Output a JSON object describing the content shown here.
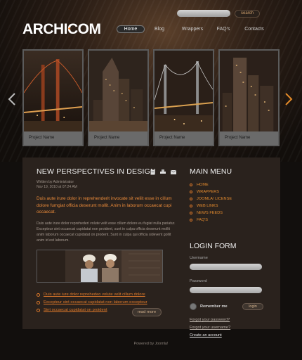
{
  "header": {
    "logo_prefix": "ARCHI",
    "logo_dot": "•",
    "logo_suffix": "COM",
    "search_placeholder": "",
    "search_button": "search"
  },
  "nav": [
    {
      "label": "Home",
      "active": true
    },
    {
      "label": "Blog",
      "active": false
    },
    {
      "label": "Wrappers",
      "active": false
    },
    {
      "label": "FAQ's",
      "active": false
    },
    {
      "label": "Contacts",
      "active": false
    }
  ],
  "gallery": {
    "prev_icon": "chevron-left-icon",
    "next_icon": "chevron-right-icon",
    "arrow_colors": {
      "left": "#bdbdbd",
      "right": "#e38a28"
    },
    "items": [
      {
        "caption": "Project Name"
      },
      {
        "caption": "Project Name"
      },
      {
        "caption": "Project Name"
      },
      {
        "caption": "Project Name"
      }
    ]
  },
  "article": {
    "title": "NEW PERSPECTIVES IN DESIGN",
    "tool_icons": [
      "pdf-icon",
      "print-icon",
      "email-icon"
    ],
    "meta_line1": "Written by Administrator",
    "meta_line2": "Nov 19, 2010 at 07:24 AM",
    "lead": "Duis aute irure dolor in reprehenderit invocate sit veliit esse in cillum dolore fumgiat officia deserunt mollit. Anim in laborum occaecat cupi occaecat.",
    "body": "Duis aute irure dolor reprehederi volute velit esse cillum dolore eu fugiat nulla pariatur. Excepteur sint occaecat cupidatat non proident, sunt in culpa officia deserunt mollit anim laborum occaecat cupidatat on prodent. Sunt in culpa qui officia sidevent gollit anim id est laborum.",
    "links": [
      "Duis aute iure dolor reprehedeo volute velit cillum dolore",
      "Excepteur sint occaecat cupidatat non laborum exceptour",
      "Sint occaecat cupidatat on proident"
    ],
    "read_more": "read more"
  },
  "sidebar": {
    "menu_title": "MAIN MENU",
    "menu_items": [
      "HOME",
      "WRAPPERS",
      "JOOMLA! LICENSE",
      "WEB LINKS",
      "NEWS FEEDS",
      "FAQ'S"
    ],
    "login_title": "LOGIN FORM",
    "username_label": "Username",
    "password_label": "Password",
    "remember_label": "Remember me",
    "login_button": "login",
    "account_links": [
      "Forgot your password?",
      "Forgot your username?",
      "Create an account"
    ]
  },
  "footer": {
    "text": "Powered by Joomla!"
  },
  "colors": {
    "accent": "#e8781f",
    "panel": "#2a221d",
    "background": "#120f0d"
  }
}
